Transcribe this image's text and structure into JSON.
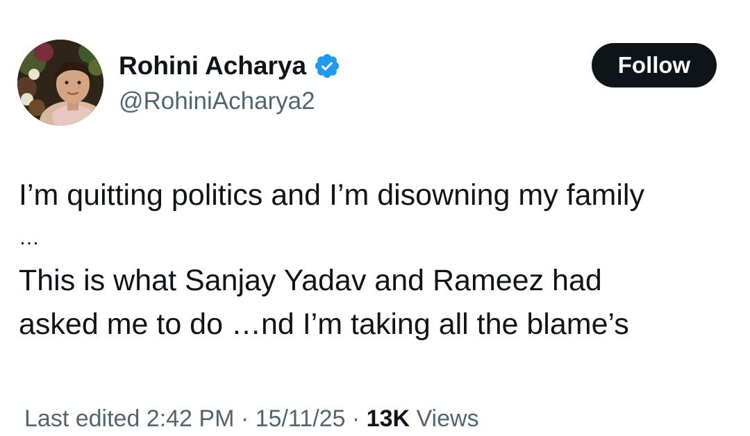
{
  "author": {
    "display_name": "Rohini Acharya",
    "handle": "@RohiniAcharya2",
    "verified_icon": "verified-badge-icon",
    "avatar": "profile-photo"
  },
  "follow_button": {
    "label": "Follow"
  },
  "tweet": {
    "lines": [
      "I’m quitting politics and I’m disowning my family",
      "…",
      "This is what Sanjay Yadav and Rameez had",
      "asked me to do …nd I’m taking all the blame’s"
    ]
  },
  "meta": {
    "edited_label": "Last edited 2:42 PM · 15/11/25",
    "separator": " · ",
    "views_count": "13K",
    "views_label": " Views"
  },
  "colors": {
    "text_primary": "#0f1419",
    "text_secondary": "#536471",
    "verified_blue": "#1d9bf0",
    "button_bg": "#0f1419",
    "button_text": "#ffffff"
  }
}
